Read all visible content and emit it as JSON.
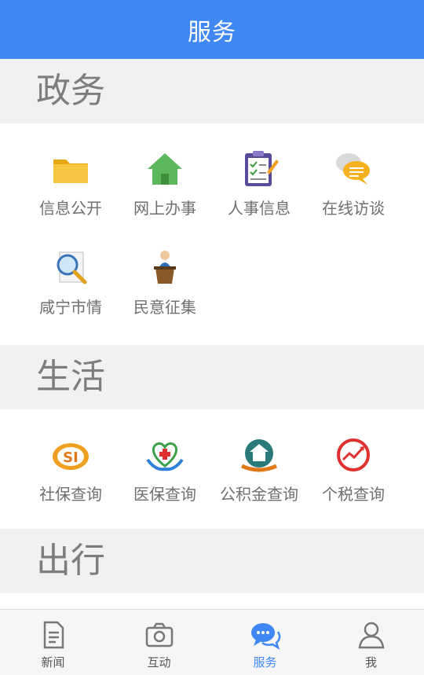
{
  "header": {
    "title": "服务"
  },
  "sections": [
    {
      "title": "政务",
      "items": [
        {
          "label": "信息公开",
          "icon": "folder-icon"
        },
        {
          "label": "网上办事",
          "icon": "house-icon"
        },
        {
          "label": "人事信息",
          "icon": "clipboard-icon"
        },
        {
          "label": "在线访谈",
          "icon": "chat-bubbles-icon"
        },
        {
          "label": "咸宁市情",
          "icon": "magnifier-document-icon"
        },
        {
          "label": "民意征集",
          "icon": "podium-icon"
        }
      ]
    },
    {
      "title": "生活",
      "items": [
        {
          "label": "社保查询",
          "icon": "social-security-icon"
        },
        {
          "label": "医保查询",
          "icon": "medical-insurance-icon"
        },
        {
          "label": "公积金查询",
          "icon": "housing-fund-icon"
        },
        {
          "label": "个税查询",
          "icon": "tax-chart-icon"
        }
      ]
    },
    {
      "title": "出行",
      "items": []
    }
  ],
  "tabbar": {
    "tabs": [
      {
        "label": "新闻",
        "icon": "news-icon",
        "active": false
      },
      {
        "label": "互动",
        "icon": "camera-icon",
        "active": false
      },
      {
        "label": "服务",
        "icon": "chat-icon",
        "active": true
      },
      {
        "label": "我",
        "icon": "user-icon",
        "active": false
      }
    ]
  },
  "colors": {
    "primary": "#3f88f3",
    "section_bg": "#f1f1f1",
    "text_gray": "#6f6f6f"
  }
}
